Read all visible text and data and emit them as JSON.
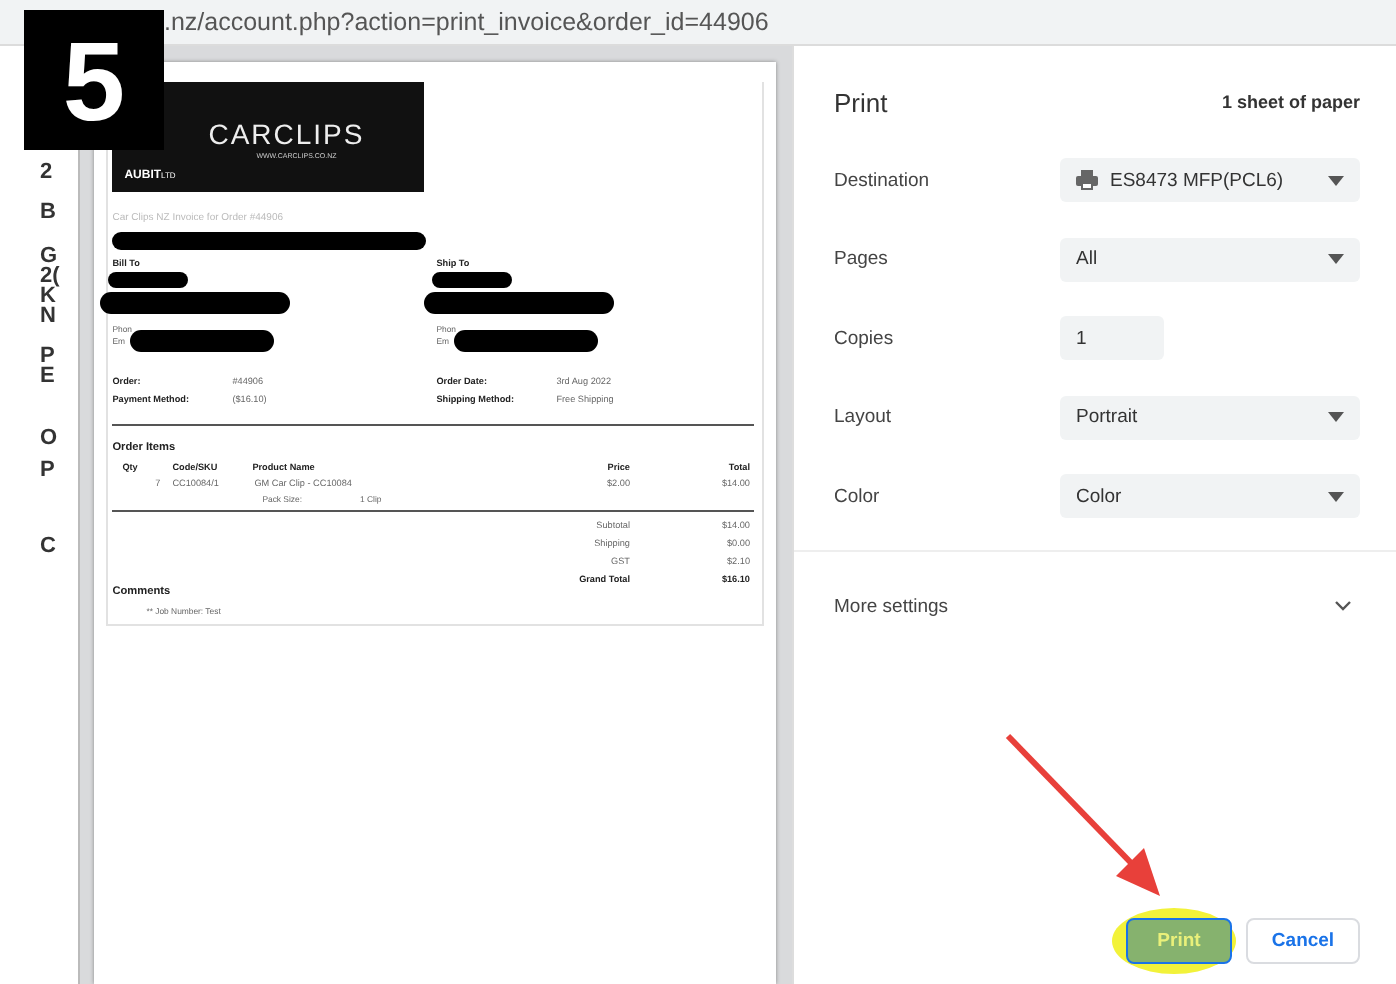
{
  "step_badge": "5",
  "address_bar": {
    "url": ".nz/account.php?action=print_invoice&order_id=44906"
  },
  "background_page": {
    "fragments": [
      "2",
      "B",
      "G",
      "2(",
      "K",
      "N",
      "P",
      "E",
      "O",
      "P",
      "C"
    ]
  },
  "invoice": {
    "logo": {
      "brand": "CARCLIPS",
      "website": "WWW.CARCLIPS.CO.NZ",
      "company": "AUBIT",
      "company_suffix": "LTD"
    },
    "title": "Car Clips NZ Invoice for Order #44906",
    "bill_to": {
      "heading": "Bill To",
      "phone_label": "Phon",
      "email_label": "Em"
    },
    "ship_to": {
      "heading": "Ship To",
      "phone_label": "Phon",
      "email_label": "Em"
    },
    "order_info": [
      {
        "label": "Order:",
        "value": "#44906"
      },
      {
        "label": "Order Date:",
        "value": "3rd Aug 2022"
      },
      {
        "label": "Payment Method:",
        "value": "($16.10)"
      },
      {
        "label": "Shipping Method:",
        "value": "Free Shipping"
      }
    ],
    "items_heading": "Order Items",
    "columns": [
      "Qty",
      "Code/SKU",
      "Product Name",
      "Price",
      "Total"
    ],
    "rows": [
      {
        "qty": "7",
        "sku": "CC10084/1",
        "product": "GM Car Clip - CC10084",
        "price": "$2.00",
        "total": "$14.00",
        "option_label": "Pack Size:",
        "option_value": "1 Clip"
      }
    ],
    "totals": [
      {
        "label": "Subtotal",
        "value": "$14.00",
        "grand": false
      },
      {
        "label": "Shipping",
        "value": "$0.00",
        "grand": false
      },
      {
        "label": "GST",
        "value": "$2.10",
        "grand": false
      },
      {
        "label": "Grand Total",
        "value": "$16.10",
        "grand": true
      }
    ],
    "comments_heading": "Comments",
    "comments": "** Job Number: Test"
  },
  "print_panel": {
    "title": "Print",
    "sheets": "1 sheet of paper",
    "settings": [
      {
        "label": "Destination",
        "kind": "destination",
        "value": "ES8473 MFP(PCL6)"
      },
      {
        "label": "Pages",
        "kind": "select",
        "value": "All"
      },
      {
        "label": "Copies",
        "kind": "number",
        "value": "1"
      },
      {
        "label": "Layout",
        "kind": "select",
        "value": "Portrait"
      },
      {
        "label": "Color",
        "kind": "select",
        "value": "Color"
      }
    ],
    "more_settings": {
      "label": "More settings",
      "expanded": false
    },
    "buttons": [
      {
        "label": "Print",
        "kind": "primary",
        "highlighted": true
      },
      {
        "label": "Cancel",
        "kind": "secondary",
        "highlighted": false
      }
    ]
  }
}
